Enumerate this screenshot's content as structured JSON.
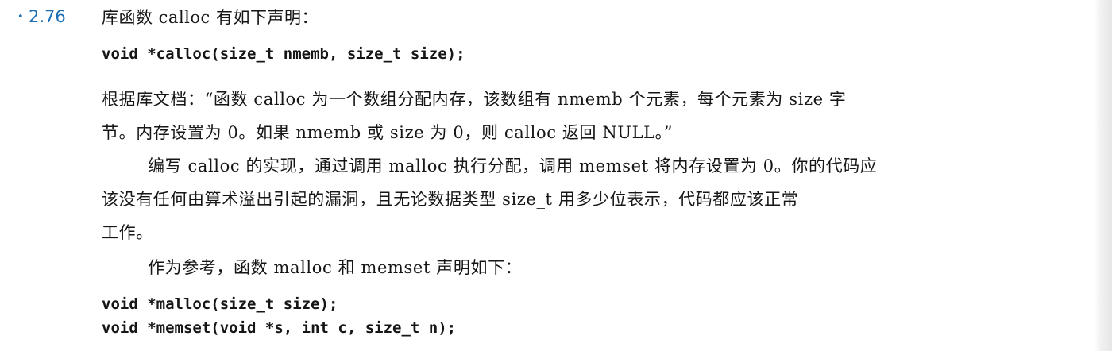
{
  "exercise": {
    "marker": "•",
    "number": "2.76",
    "title": "库函数 calloc 有如下声明："
  },
  "declaration": "void *calloc(size_t nmemb, size_t size);",
  "paragraph1": {
    "line1": "根据库文档：“函数 calloc 为一个数组分配内存，该数组有 nmemb 个元素，每个元素为 size 字",
    "line2": "节。内存设置为 0。如果 nmemb 或 size 为 0，则 calloc 返回 NULL。”"
  },
  "paragraph2": {
    "line1": "编写 calloc 的实现，通过调用 malloc 执行分配，调用 memset 将内存设置为 0。你的代码应",
    "line2": "该没有任何由算术溢出引起的漏洞，且无论数据类型 size_t 用多少位表示，代码都应该正常",
    "line3": "工作。"
  },
  "paragraph3": "作为参考，函数 malloc 和 memset 声明如下：",
  "reference_code": [
    "void *malloc(size_t size);",
    "void *memset(void *s, int c, size_t n);"
  ]
}
